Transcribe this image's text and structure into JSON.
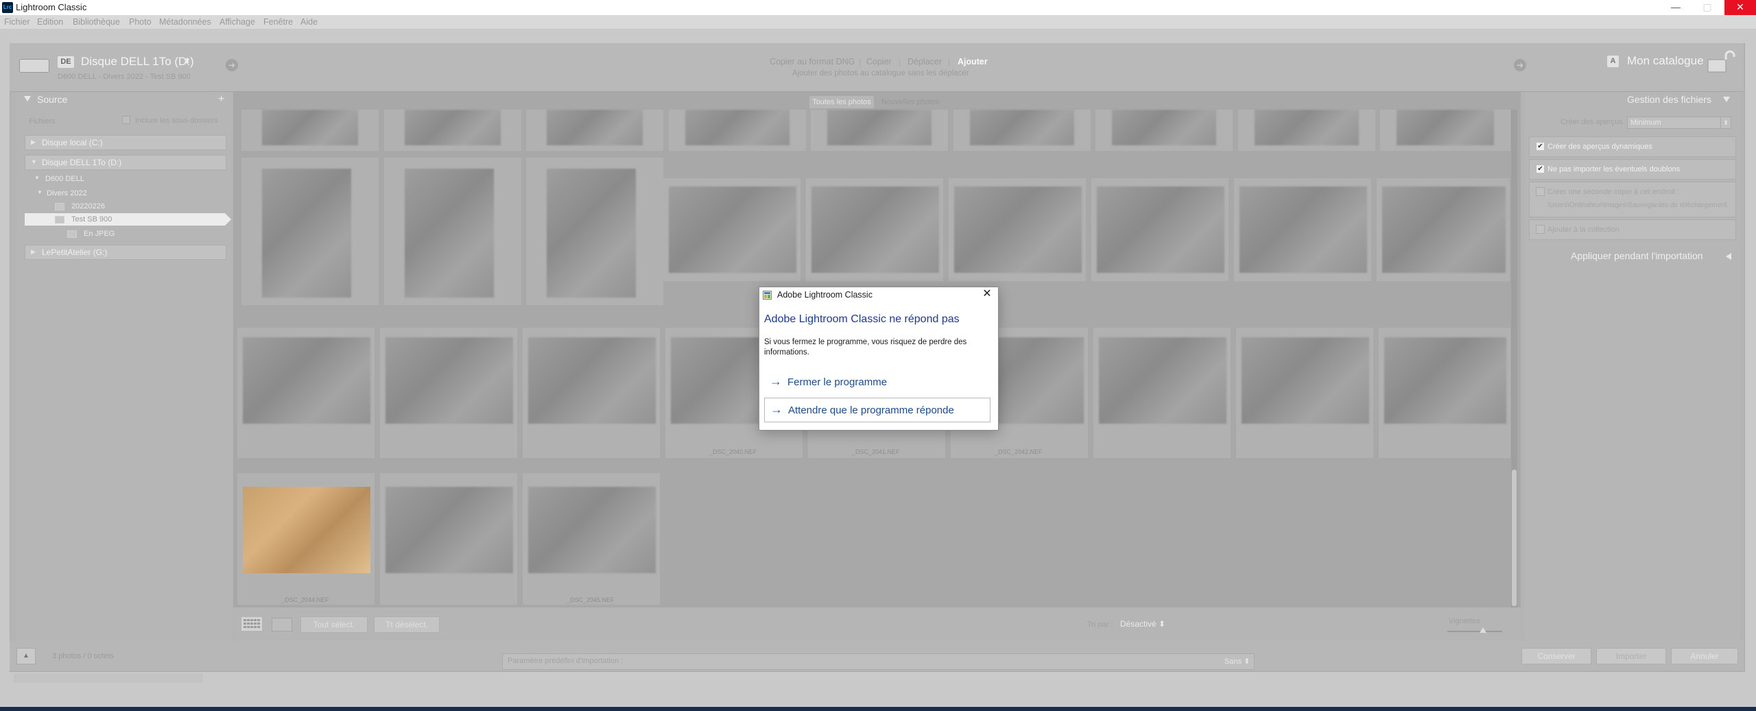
{
  "window": {
    "app_icon": "Lrc",
    "title": "Lightroom Classic",
    "minimize": "—",
    "maximize": "▢",
    "close": "✕"
  },
  "menu": [
    "Fichier",
    "Edition",
    "Bibliothèque",
    "Photo",
    "Métadonnées",
    "Affichage",
    "Fenêtre",
    "Aide"
  ],
  "header": {
    "drive_badge": "DE",
    "source_drive": "Disque DELL 1To (D:)",
    "source_path": "D600 DELL - Divers 2022 - Test SB 900",
    "modes": [
      "Copier au format DNG",
      "Copier",
      "Déplacer",
      "Ajouter"
    ],
    "mode_description": "Ajouter des photos au catalogue sans les déplacer",
    "catalog_badge": "A",
    "catalog": "Mon catalogue"
  },
  "left_panel": {
    "title": "Source",
    "add": "+",
    "files_label": "Fichiers",
    "include_subfolders": "Inclure les sous-dossiers",
    "volumes": [
      "Disque local (C:)",
      "Disque DELL 1To (D:)",
      "LePetitAtelier (G:)"
    ],
    "folders": [
      "D600 DELL",
      "Divers 2022",
      "20220226",
      "Test SB 900",
      "En JPEG"
    ]
  },
  "grid": {
    "tabs": [
      "Toutes les photos",
      "Nouvelles photos"
    ],
    "names": [
      "_DSC_2040.NEF",
      "_DSC_2041.NEF",
      "_DSC_2042.NEF",
      "_DSC_2044.NEF",
      "_DSC_2045.NEF"
    ]
  },
  "toolbar": {
    "select_all": "Tout sélect.",
    "deselect_all": "Tt désélect.",
    "sort_label": "Tri par :",
    "sort_value": "Désactivé ⬍",
    "thumbnails_label": "Vignettes"
  },
  "right_panel": {
    "title": "Gestion des fichiers",
    "preview_label": "Créer des aperçus",
    "preview_value": "Minimum",
    "preview_arrow": "⬍",
    "check_mark": "✔",
    "smart_previews": "Créer des aperçus dynamiques",
    "no_duplicates": "Ne pas importer les éventuels doublons",
    "second_copy": "Créer une seconde copie à cet endroit :",
    "second_copy_path": "\\Users\\Ordinateur\\Images\\Sauvegardes de téléchargement",
    "add_to_collection": "Ajouter à la collection",
    "apply_during_import": "Appliquer pendant l'importation"
  },
  "bottom": {
    "collapse": "▲",
    "photo_count": "3 photos / 0 octets",
    "preset_label": "Paramètre prédéfini d'importation :",
    "preset_value": "Sans ⬍",
    "keep": "Conserver",
    "import": "Importer",
    "cancel": "Annuler"
  },
  "dialog": {
    "title": "Adobe Lightroom Classic",
    "close": "✕",
    "heading": "Adobe Lightroom Classic ne répond pas",
    "body": "Si vous fermez le programme, vous risquez de perdre des informations.",
    "arrow": "→",
    "option_close": "Fermer le programme",
    "option_wait": "Attendre que le programme réponde"
  }
}
